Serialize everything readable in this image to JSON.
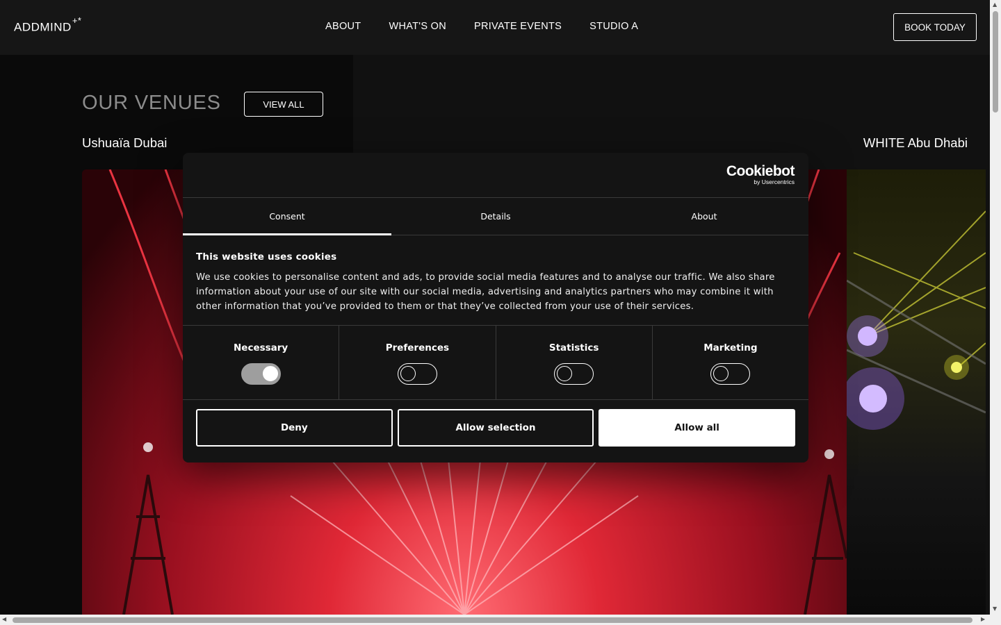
{
  "header": {
    "logo": "ADDMIND",
    "logo_mark": "+*",
    "nav": [
      "ABOUT",
      "WHAT'S ON",
      "PRIVATE EVENTS",
      "STUDIO A"
    ],
    "book_label": "BOOK TODAY"
  },
  "venues": {
    "title": "OUR VENUES",
    "view_all": "VIEW ALL",
    "left_name": "Ushuaïa Dubai",
    "right_name": "WHITE Abu Dhabi"
  },
  "cookie": {
    "brand": "Cookiebot",
    "brand_sub": "by Usercentrics",
    "tabs": [
      "Consent",
      "Details",
      "About"
    ],
    "heading": "This website uses cookies",
    "body": "We use cookies to personalise content and ads, to provide social media features and to analyse our traffic. We also share information about your use of our site with our social media, advertising and analytics partners who may combine it with other information that you’ve provided to them or that they’ve collected from your use of their services.",
    "categories": [
      "Necessary",
      "Preferences",
      "Statistics",
      "Marketing"
    ],
    "buttons": {
      "deny": "Deny",
      "allow_selection": "Allow selection",
      "allow_all": "Allow all"
    }
  },
  "colors": {
    "header_bg": "#161616",
    "dialog_bg": "#141414",
    "muted_title": "#8c8c8c"
  }
}
